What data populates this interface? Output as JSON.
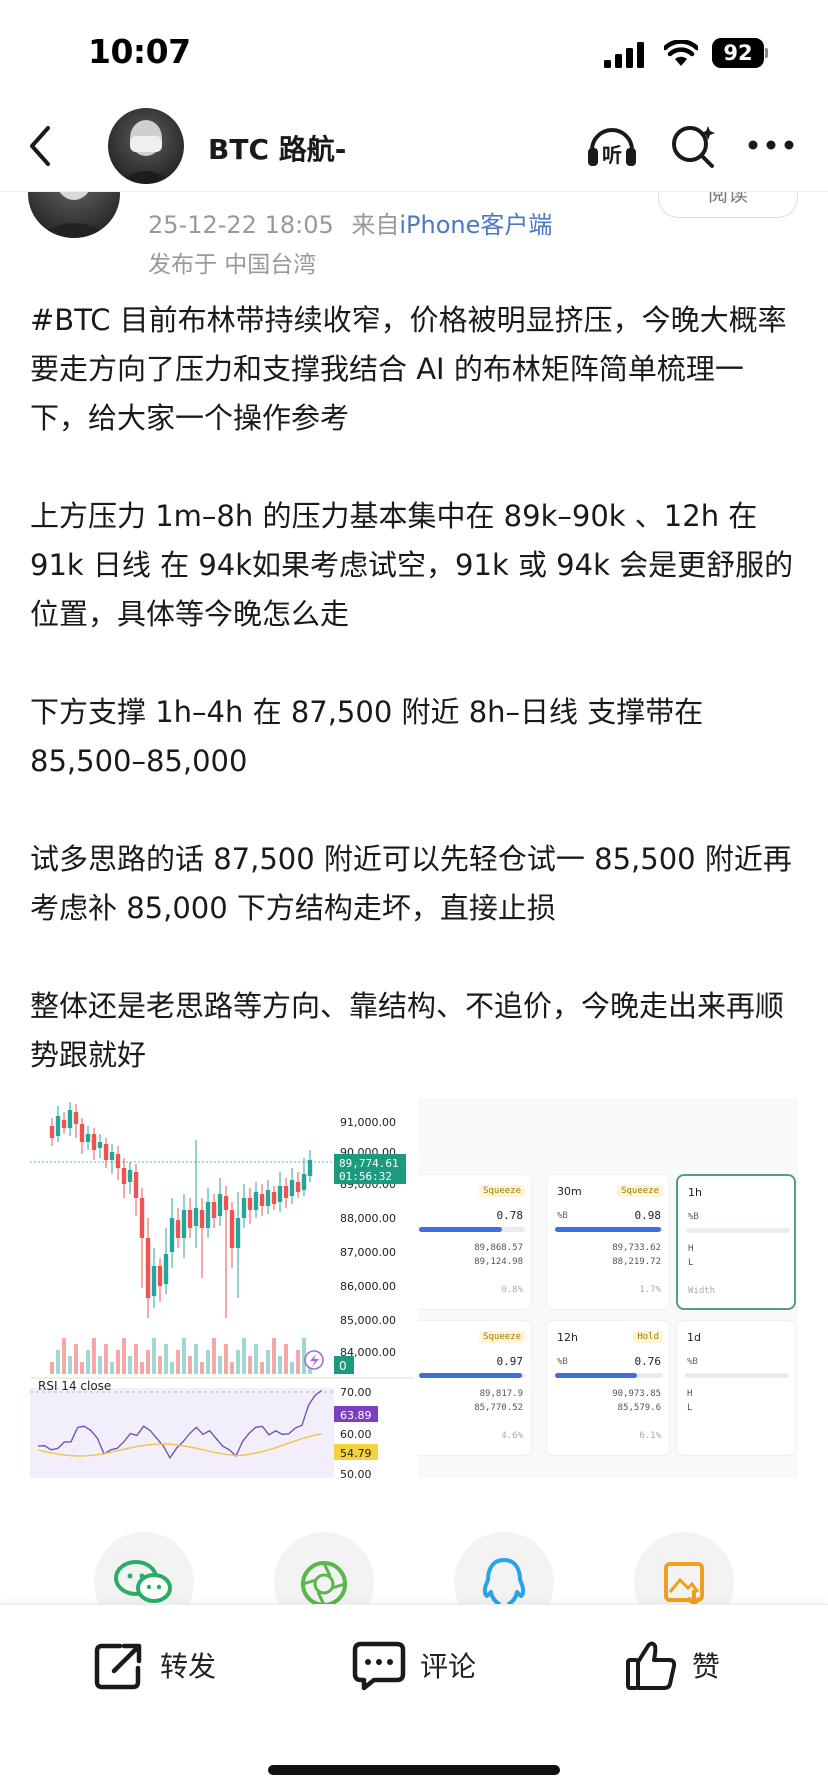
{
  "status_bar": {
    "time": "10:07",
    "battery": "92",
    "icons": [
      "signal-icon",
      "wifi-icon",
      "battery-icon"
    ]
  },
  "nav": {
    "title": "BTC 路航-",
    "icons": [
      "back-icon",
      "listen-icon",
      "search-icon",
      "more-icon"
    ],
    "listen_label": "听"
  },
  "post": {
    "time": "25-12-22 18:05",
    "source_prefix": "来自",
    "source": "iPhone客户端",
    "location": "发布于 中国台湾",
    "read_label": "阅读",
    "paragraphs": [
      "#BTC 目前布林带持续收窄，价格被明显挤压，今晚大概率要走方向了压力和支撑我结合 AI 的布林矩阵简单梳理一下，给大家一个操作参考",
      "上方压力 1m–8h 的压力基本集中在 89k–90k 、12h 在 91k 日线 在 94k如果考虑试空，91k 或 94k 会是更舒服的位置，具体等今晚怎么走",
      "下方支撑 1h–4h 在 87,500 附近 8h–日线 支撑带在 85,500–85,000",
      "试多思路的话 87,500 附近可以先轻仓试一 85,500 附近再考虑补 85,000 下方结构走坏，直接止损",
      "整体还是老思路等方向、靠结构、不追价，今晚走出来再顺势跟就好"
    ]
  },
  "chart_image": {
    "price_ticks": [
      "91,000.00",
      "90,000.00",
      "89,000.00",
      "88,000.00",
      "87,000.00",
      "86,000.00",
      "85,000.00",
      "84,000.00"
    ],
    "current_price": "89,774.61",
    "countdown": "01:56:32",
    "volume_badge": "0",
    "rsi_label": "RSI 14 close",
    "rsi_ticks": [
      "70.00",
      "60.00",
      "50.00"
    ],
    "rsi_value": "63.89",
    "rsi_ma": "54.79",
    "colors": {
      "up": "#26a69a",
      "down": "#ef5350",
      "rsi": "#7e57c2",
      "rsi_ma": "#f5c542"
    }
  },
  "matrix_image": {
    "cards": [
      {
        "tf": "",
        "tag": "Squeeze",
        "value_label": "",
        "value": "0.78",
        "h": "89,868.57",
        "l": "89,124.98",
        "width": "0.8%"
      },
      {
        "tf": "30m",
        "tag": "Squeeze",
        "value_label": "%B",
        "value": "0.98",
        "h": "89,733.62",
        "l": "88,219.72",
        "width": "1.7%"
      },
      {
        "tf": "1h",
        "tag": "",
        "value_label": "%B",
        "value": "",
        "h": "H",
        "l": "L",
        "width": "Width"
      },
      {
        "tf": "",
        "tag": "Squeeze",
        "value_label": "",
        "value": "0.97",
        "h": "89,817.9",
        "l": "85,770.52",
        "width": "4.6%"
      },
      {
        "tf": "12h",
        "tag": "Hold",
        "value_label": "%B",
        "value": "0.76",
        "h": "90,973.85",
        "l": "85,579.6",
        "width": "6.1%"
      },
      {
        "tf": "1d",
        "tag": "",
        "value_label": "%B",
        "value": "",
        "h": "H",
        "l": "L",
        "width": ""
      }
    ]
  },
  "share": {
    "icons": [
      "wechat-icon",
      "moments-icon",
      "qq-icon",
      "save-image-icon"
    ]
  },
  "actions": {
    "repost": "转发",
    "comment": "评论",
    "like": "赞"
  }
}
